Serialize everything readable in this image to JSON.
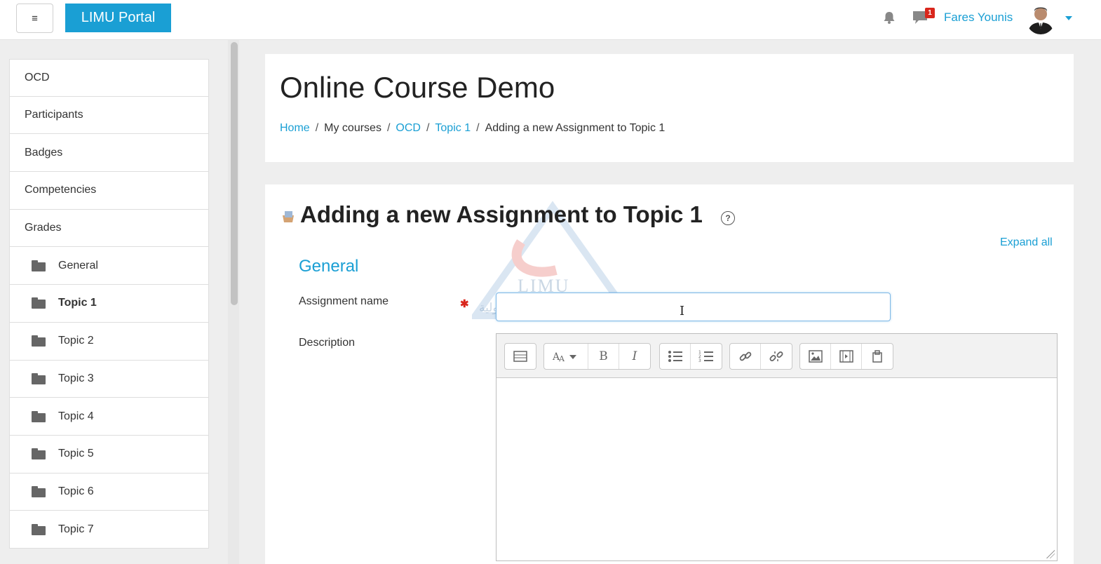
{
  "navbar": {
    "menu_icon": "hamburger-icon",
    "brand": "LIMU Portal",
    "notification_count": "1",
    "user_name": "Fares Younis"
  },
  "sidebar": {
    "items": [
      {
        "label": "OCD",
        "icon": ""
      },
      {
        "label": "Participants",
        "icon": ""
      },
      {
        "label": "Badges",
        "icon": ""
      },
      {
        "label": "Competencies",
        "icon": ""
      },
      {
        "label": "Grades",
        "icon": ""
      },
      {
        "label": "General",
        "icon": "folder-icon"
      },
      {
        "label": "Topic 1",
        "icon": "folder-icon",
        "active": true
      },
      {
        "label": "Topic 2",
        "icon": "folder-icon"
      },
      {
        "label": "Topic 3",
        "icon": "folder-icon"
      },
      {
        "label": "Topic 4",
        "icon": "folder-icon"
      },
      {
        "label": "Topic 5",
        "icon": "folder-icon"
      },
      {
        "label": "Topic 6",
        "icon": "folder-icon"
      },
      {
        "label": "Topic 7",
        "icon": "folder-icon"
      }
    ]
  },
  "header": {
    "title": "Online Course Demo",
    "breadcrumb": {
      "home": "Home",
      "my_courses": "My courses",
      "course": "OCD",
      "topic": "Topic 1",
      "current": "Adding a new Assignment to Topic 1",
      "separator": "/"
    }
  },
  "form": {
    "heading": "Adding a new Assignment to Topic 1",
    "help": "?",
    "expand_all": "Expand all",
    "section": "General",
    "assignment_name_label": "Assignment name",
    "assignment_name_value": "",
    "required_mark": "✱",
    "description_label": "Description",
    "watermark": {
      "latin": "LIMU",
      "arabic": "الجامعة الليبية الدولية"
    }
  },
  "editor_toolbar": {
    "bold": "B",
    "italic": "I"
  },
  "colors": {
    "accent": "#1a9fd4",
    "badge": "#d9261c",
    "page_bg": "#eeeeee"
  }
}
